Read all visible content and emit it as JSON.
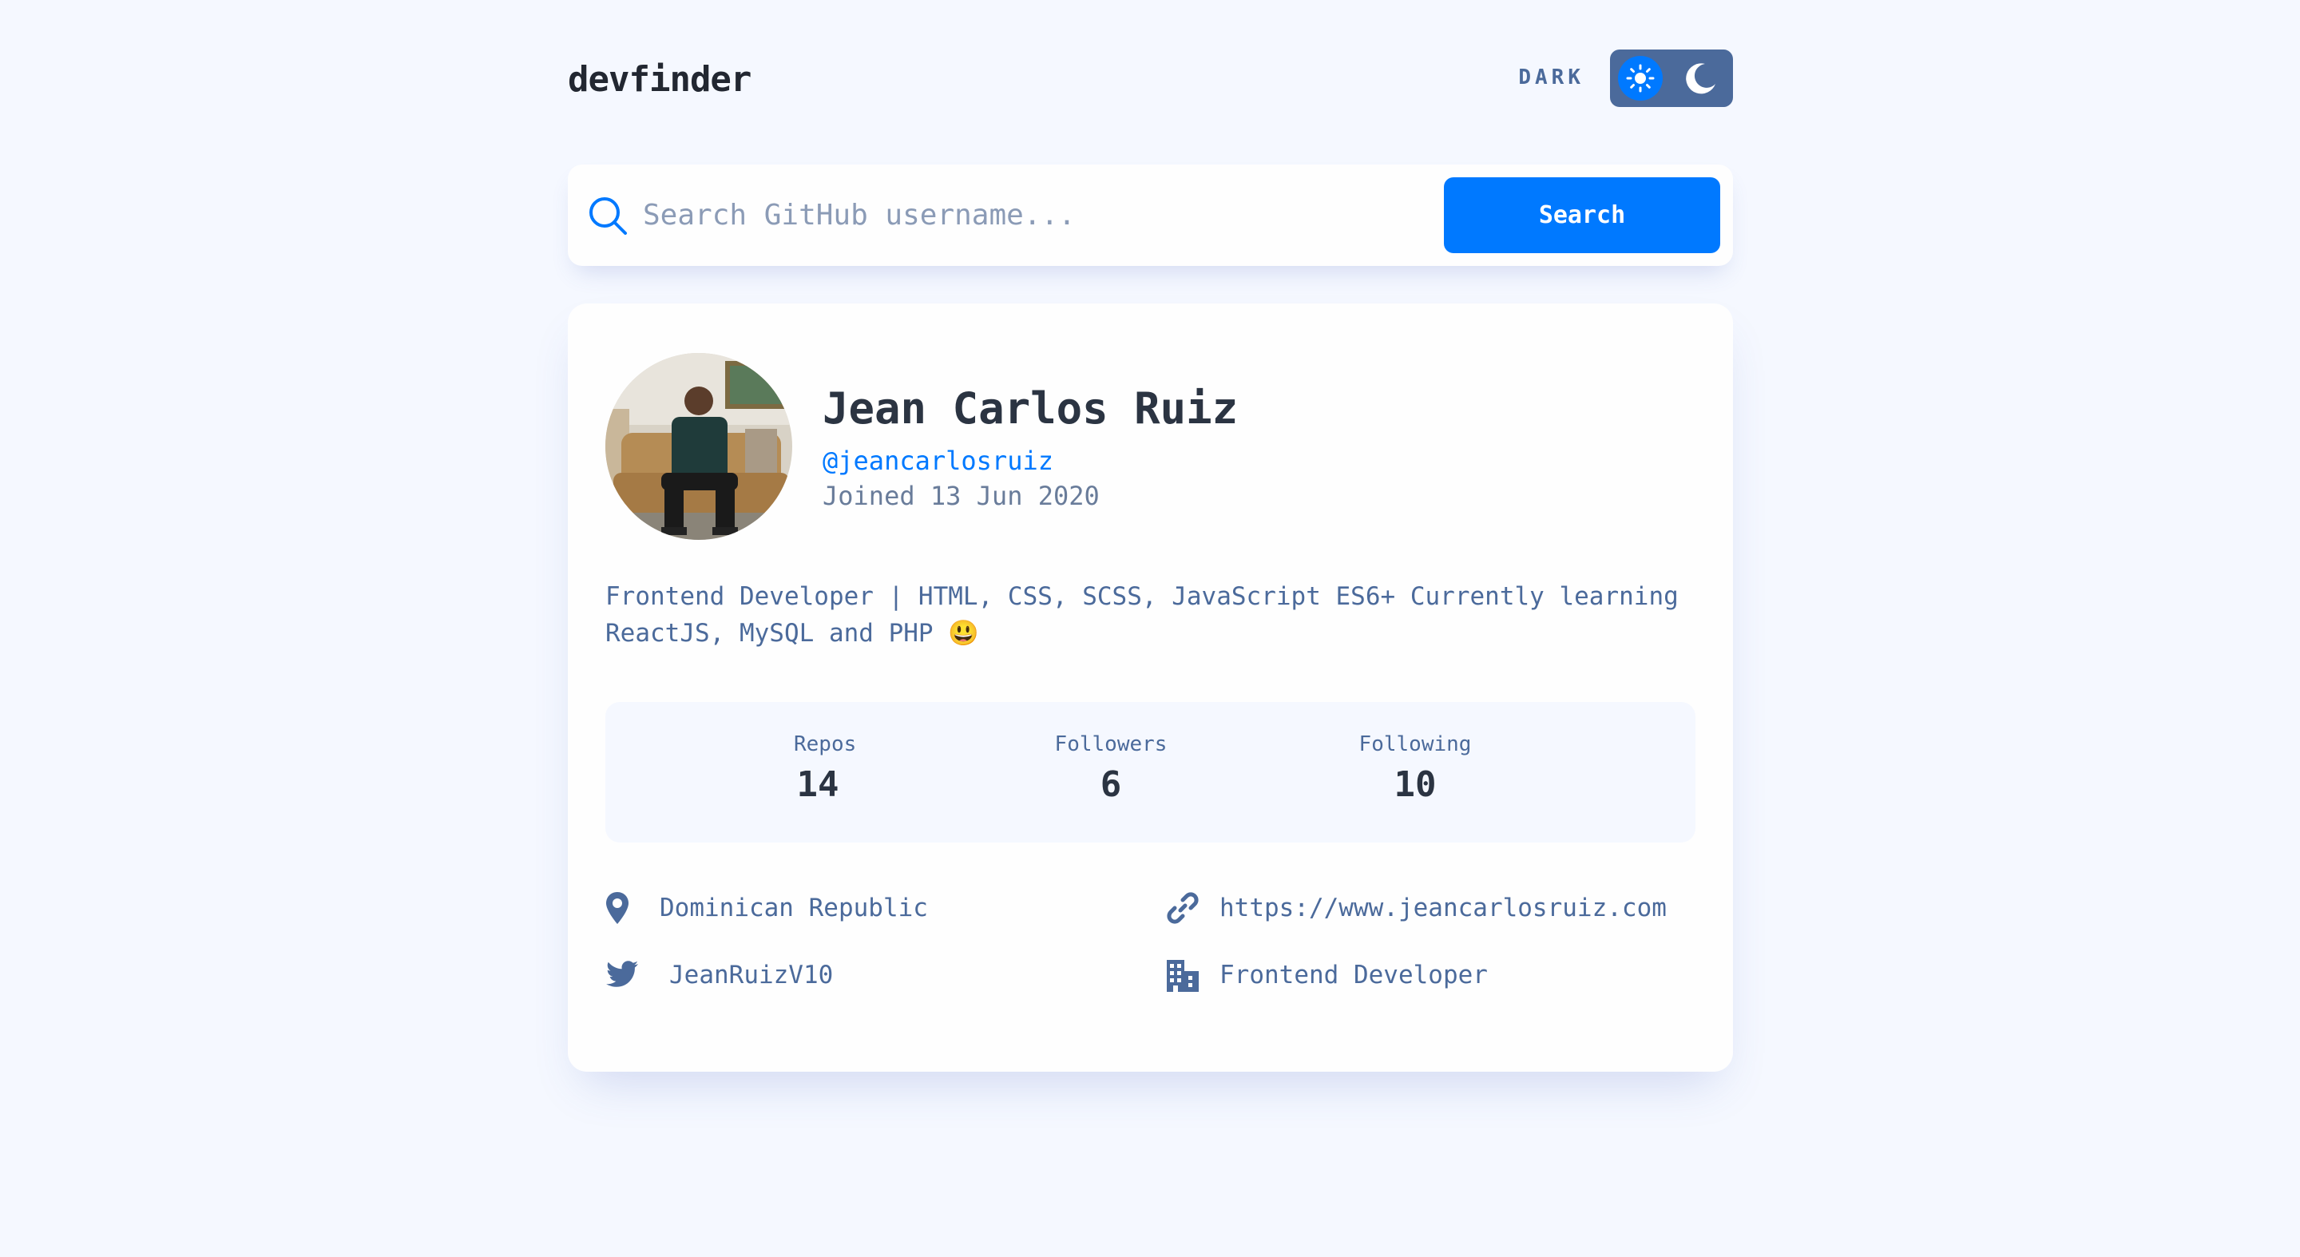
{
  "header": {
    "logo": "devfinder",
    "mode_label": "DARK"
  },
  "search": {
    "placeholder": "Search GitHub username...",
    "value": "",
    "button_label": "Search"
  },
  "profile": {
    "name": "Jean Carlos Ruiz",
    "login": "@jeancarlosruiz",
    "joined": "Joined 13 Jun 2020",
    "bio_line1": "Frontend Developer | HTML, CSS, SCSS, JavaScript ES6+  Currently learning",
    "bio_line2": "ReactJS, MySQL and PHP 😃"
  },
  "stats": [
    {
      "label": "Repos",
      "value": "14"
    },
    {
      "label": "Followers",
      "value": "6"
    },
    {
      "label": "Following",
      "value": "10"
    }
  ],
  "links": {
    "location": "Dominican Republic",
    "website": "https://www.jeancarlosruiz.com",
    "twitter": "JeanRuizV10",
    "company": "Frontend Developer"
  },
  "colors": {
    "accent": "#0079ff",
    "text": "#4b6a9b",
    "background": "#f5f8ff"
  },
  "icons": [
    "sun-icon",
    "moon-icon",
    "search-icon",
    "location-icon",
    "link-icon",
    "twitter-icon",
    "building-icon"
  ]
}
